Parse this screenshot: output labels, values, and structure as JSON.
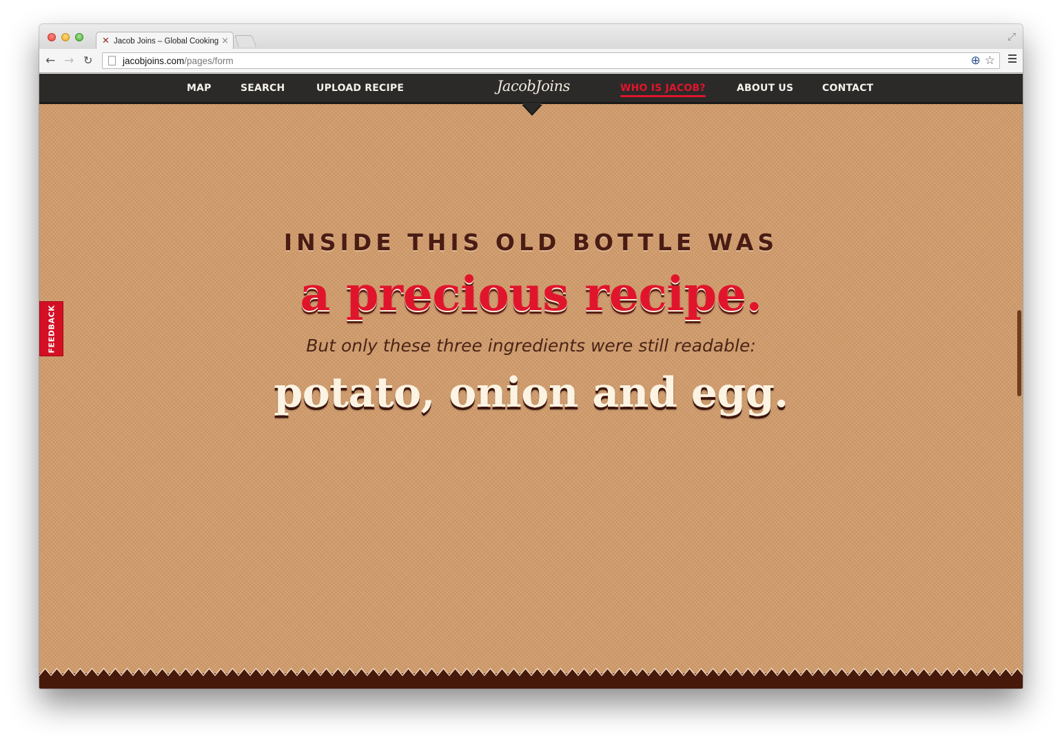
{
  "browser": {
    "tab_title": "Jacob Joins – Global Cooking",
    "tab_close": "×",
    "url_host": "jacobjoins.com",
    "url_path": "/pages/form"
  },
  "site": {
    "nav": {
      "map": "MAP",
      "search": "SEARCH",
      "upload": "UPLOAD RECIPE",
      "who": "WHO IS JACOB?",
      "about": "ABOUT US",
      "contact": "CONTACT"
    },
    "logo": "JacobJoins",
    "feedback": "FEEDBACK",
    "hero": {
      "line1": "INSIDE THIS OLD BOTTLE WAS",
      "line2": "a precious recipe.",
      "line3": "But only these three ingredients were still readable:",
      "line4": "potato, onion and egg."
    }
  },
  "colors": {
    "background": "#d29c6b",
    "accent_red": "#e0152c",
    "nav_dark": "#2c2a28",
    "footer_brown": "#47190b"
  }
}
